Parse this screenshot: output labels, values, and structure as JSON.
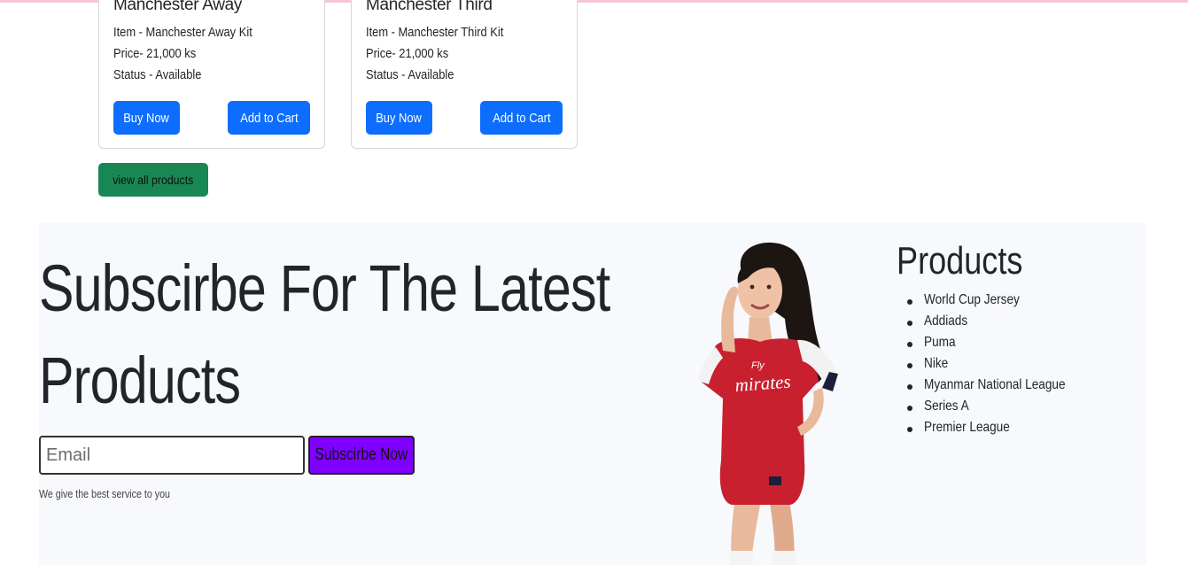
{
  "products_cards": [
    {
      "title": "Manchester Away",
      "item": "Item - Manchester Away Kit",
      "price": "Price- 21,000 ks",
      "status": "Status - Available",
      "buy_label": "Buy Now",
      "cart_label": "Add to Cart"
    },
    {
      "title": "Manchester Third",
      "item": "Item - Manchester Third Kit",
      "price": "Price- 21,000 ks",
      "status": "Status - Available",
      "buy_label": "Buy Now",
      "cart_label": "Add to Cart"
    }
  ],
  "view_all_label": "view all products",
  "subscribe": {
    "headline": "Subscirbe For The Latest Products",
    "email_placeholder": "Email",
    "button_label": "Subscirbe Now",
    "tagline": "We give the best service to you"
  },
  "products_menu": {
    "title": "Products",
    "items": [
      "World Cup Jersey",
      "Addiads",
      "Puma",
      "Nike",
      "Myanmar National League",
      "Series A",
      "Premier League"
    ]
  },
  "colors": {
    "primary_blue": "#0d6efd",
    "success_green": "#198754",
    "subscribe_purple": "#7f00ff",
    "jersey_red": "#c8202f"
  }
}
